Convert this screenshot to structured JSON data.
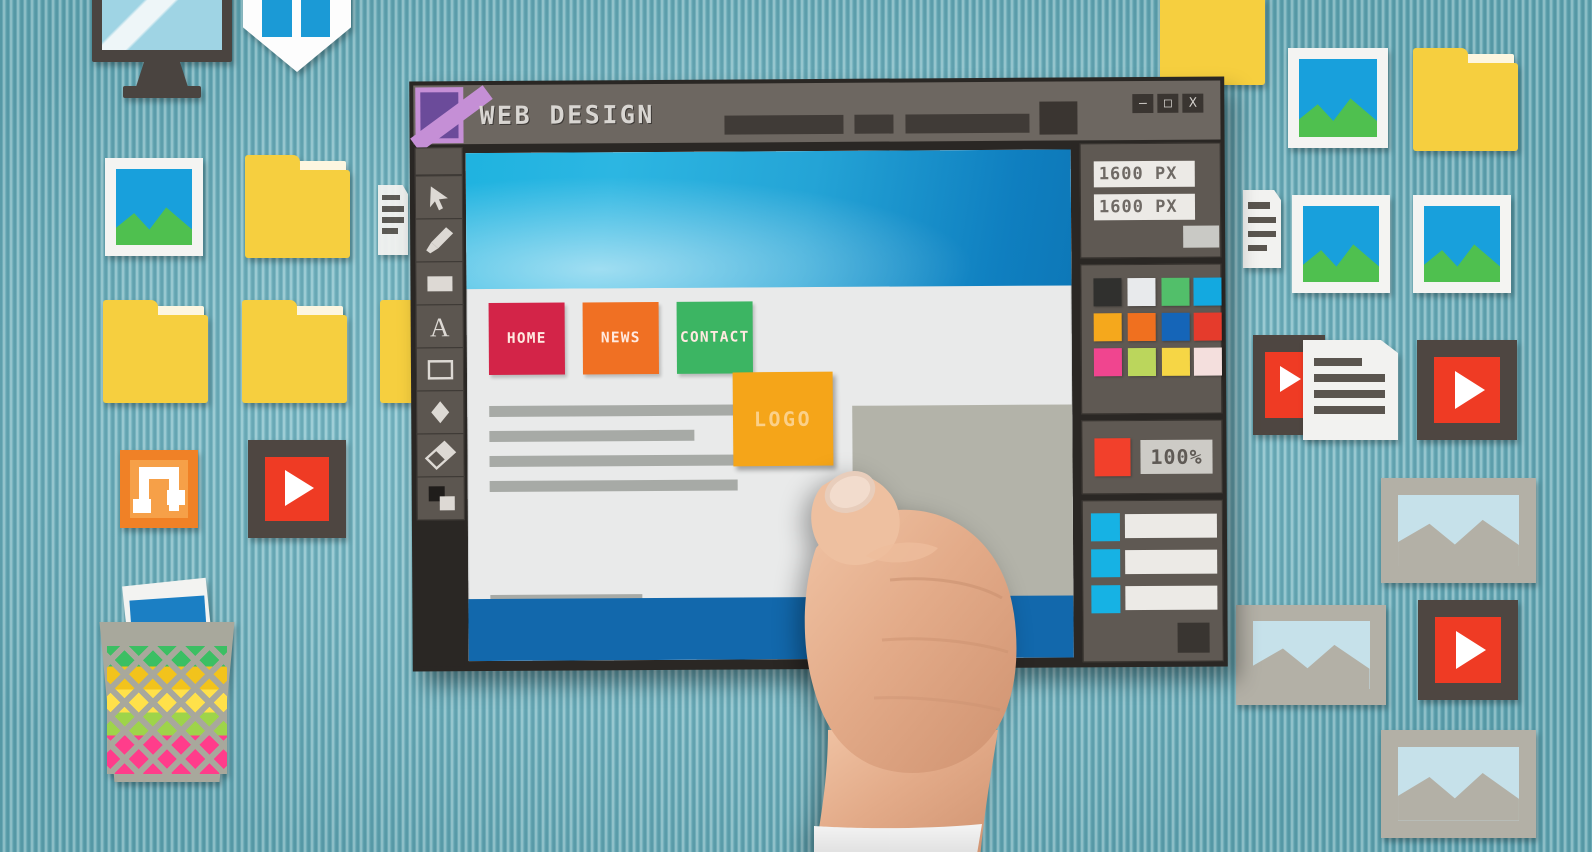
{
  "window": {
    "title": "WEB DESIGN",
    "app_icon": "app-logo-icon",
    "controls": {
      "minimize": "—",
      "maximize": "□",
      "close": "X"
    }
  },
  "toolbar": {
    "tools": [
      {
        "name": "blank-tool",
        "icon": "blank-icon"
      },
      {
        "name": "select-tool",
        "icon": "cursor-arrow-icon"
      },
      {
        "name": "brush-tool",
        "icon": "paintbrush-icon"
      },
      {
        "name": "fill-rect-tool",
        "icon": "filled-rectangle-icon"
      },
      {
        "name": "text-tool",
        "icon": "text-a-icon"
      },
      {
        "name": "rect-tool",
        "icon": "rectangle-outline-icon"
      },
      {
        "name": "shape-tool",
        "icon": "diamond-icon"
      },
      {
        "name": "eraser-tool",
        "icon": "eraser-icon"
      },
      {
        "name": "layers-tool",
        "icon": "two-squares-icon"
      }
    ]
  },
  "canvas": {
    "hero_banner": "blue-gradient-hero",
    "nav_buttons": [
      {
        "label": "HOME",
        "color": "#d32448"
      },
      {
        "label": "NEWS",
        "color": "#f07023"
      },
      {
        "label": "CONTACT",
        "color": "#3cb563"
      }
    ],
    "text_lines": 5,
    "image_block": "gray-image-placeholder",
    "footer": "blue-footer-bar"
  },
  "dragged_element": {
    "label": "LOGO",
    "color": "#f5a519"
  },
  "inspector": {
    "size_panel": {
      "width_value": "1600 PX",
      "height_value": "1600 PX",
      "apply_button": "apply-button"
    },
    "palette": {
      "swatches": [
        "#30302e",
        "#e8eaec",
        "#52bf6a",
        "#13a9e0",
        "#f5a81c",
        "#f0701f",
        "#1565b8",
        "#e53b2c",
        "#f0458f",
        "#bbd65c",
        "#f6d645",
        "#f4dfdd"
      ]
    },
    "zoom_panel": {
      "color_chip": "#f2402b",
      "zoom_value": "100%"
    },
    "layers_panel": {
      "rows": [
        {
          "thumb": "#16b2e4",
          "name": "layer-row-1"
        },
        {
          "thumb": "#16b2e4",
          "name": "layer-row-2"
        },
        {
          "thumb": "#16b2e4",
          "name": "layer-row-3"
        }
      ],
      "options_button": "layer-options-button"
    }
  },
  "desktop": {
    "icons": [
      {
        "type": "monitor",
        "label": ""
      },
      {
        "type": "shield",
        "label": ""
      },
      {
        "type": "photo",
        "label": ""
      },
      {
        "type": "folder",
        "label": ""
      },
      {
        "type": "folder",
        "label": ""
      },
      {
        "type": "folder",
        "label": ""
      },
      {
        "type": "folder",
        "label": ""
      },
      {
        "type": "music",
        "label": ""
      },
      {
        "type": "video",
        "label": ""
      },
      {
        "type": "trash",
        "label": ""
      },
      {
        "type": "document",
        "label": ""
      },
      {
        "type": "ghost-image",
        "label": ""
      }
    ]
  }
}
